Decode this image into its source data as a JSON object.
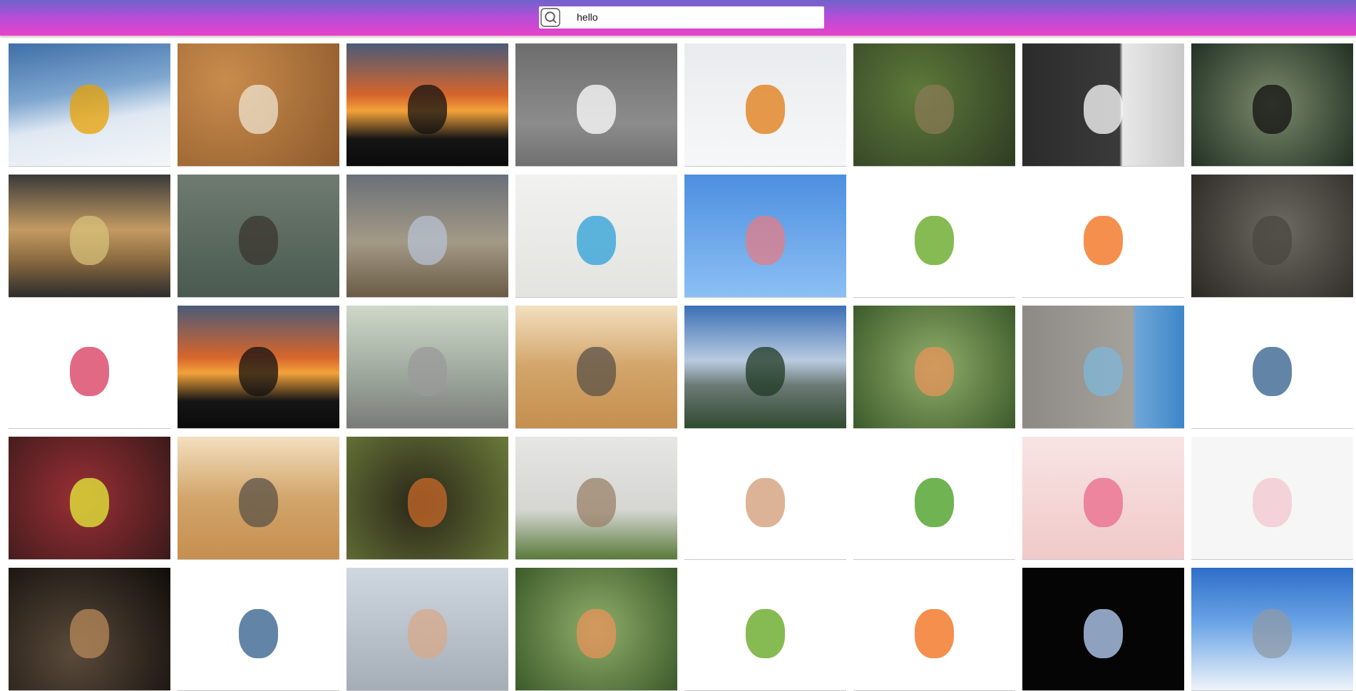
{
  "search": {
    "value": "hello",
    "icon": "search-icon"
  },
  "palette": {
    "header_gradient": [
      "#6f63c9",
      "#b14fd8",
      "#ea41c9"
    ]
  },
  "images": [
    {
      "name": "skier-on-slope",
      "bg": "linear-gradient(170deg,#3f6fa8 0%,#7ea6cf 40%,#dfe8f2 62%,#f4f6f8 100%)",
      "accent": "#e8a000"
    },
    {
      "name": "scrabble-tiles-all",
      "bg": "radial-gradient(circle at 30% 30%,#c98c4c,#8e5a2c)",
      "accent": "#efe3cf"
    },
    {
      "name": "hikers-silhouette-sunset",
      "bg": "linear-gradient(180deg,#4b5b78 0%,#d6652c 42%,#f3a23a 55%,#151515 78%,#0b0b0b 100%)",
      "accent": "#111111"
    },
    {
      "name": "hello-kitty-figure",
      "bg": "linear-gradient(180deg,#6d6d6d 0%,#8c8c8c 65%,#707070 100%)",
      "accent": "#ffffff"
    },
    {
      "name": "hello-mug-and-phone",
      "bg": "linear-gradient(180deg,#e9ecee 0%,#f6f7f8 100%)",
      "accent": "#e07a10"
    },
    {
      "name": "flowers-in-vase-cafe",
      "bg": "radial-gradient(circle at 40% 40%,#5d7a3a,#2f3b23)",
      "accent": "#8a7a55"
    },
    {
      "name": "bonjour-door",
      "bg": "linear-gradient(90deg,#2b2b2b 0%,#3a3a3a 60%,#e8e8e8 62%,#c9c9c9 100%)",
      "accent": "#ffffff"
    },
    {
      "name": "hello-rainy-window",
      "bg": "radial-gradient(circle at 50% 50%,#7a8a6a,#223024)",
      "accent": "#111111"
    },
    {
      "name": "beach-sunset-people",
      "bg": "linear-gradient(180deg,#3a3a3a 0%,#c49a62 45%,#8a6a3f 70%,#2d2d2d 100%)",
      "accent": "#d7c07a"
    },
    {
      "name": "seal-waving",
      "bg": "linear-gradient(180deg,#6f7b70 0%,#4a5a50 100%)",
      "accent": "#3a352d"
    },
    {
      "name": "crane-in-field",
      "bg": "linear-gradient(180deg,#6a6f79 0%,#a39a86 55%,#6a5b46 100%)",
      "accent": "#b7c2d3"
    },
    {
      "name": "notebook-hello-speech-bubbles",
      "bg": "linear-gradient(180deg,#f1f1ef 0%,#e3e3e0 100%)",
      "accent": "#2ba0d8"
    },
    {
      "name": "ostrich-open-beak",
      "bg": "linear-gradient(180deg,#4d8fe0 0%,#8cc0f4 100%)",
      "accent": "#e47c86"
    },
    {
      "name": "frog-hello-light-switch",
      "bg": "#ffffff",
      "accent": "#5da31a"
    },
    {
      "name": "dog-hello-light-switch",
      "bg": "#ffffff",
      "accent": "#f26a11"
    },
    {
      "name": "tortoise-closeup",
      "bg": "radial-gradient(circle at 55% 45%,#6d6a62,#2a2824)",
      "accent": "#4a4740"
    },
    {
      "name": "hello-kitty-lollipop",
      "bg": "#ffffff",
      "accent": "#d8375a"
    },
    {
      "name": "hikers-silhouette-sunset-2",
      "bg": "linear-gradient(180deg,#4b5b78 0%,#d6652c 42%,#f3a23a 55%,#151515 78%,#0b0b0b 100%)",
      "accent": "#111111"
    },
    {
      "name": "stone-statue-waving",
      "bg": "linear-gradient(180deg,#cfd8c8 0%,#9aa59a 60%,#7a7a78 100%)",
      "accent": "#9a9a9a"
    },
    {
      "name": "cat-and-hand",
      "bg": "linear-gradient(180deg,#f3dfc0 0%,#d2a56a 50%,#c58f4f 100%)",
      "accent": "#5a5247"
    },
    {
      "name": "mountain-forest-view",
      "bg": "linear-gradient(180deg,#3c6fb6 0%,#b9cbe0 45%,#6c7a76 65%,#2f4a2f 100%)",
      "accent": "#1f3a23"
    },
    {
      "name": "goose-closeup",
      "bg": "radial-gradient(circle at 50% 50%,#8fae6a,#3c5a2a)",
      "accent": "#e8935a"
    },
    {
      "name": "hello-beautiful-wall",
      "bg": "linear-gradient(90deg,#8d8a86 0%,#a5a19b 68%,#6fa6d8 70%,#3d86c9 100%)",
      "accent": "#7fb7d9"
    },
    {
      "name": "woman-surprised-red-hair",
      "bg": "#ffffff",
      "accent": "#2d5b8a"
    },
    {
      "name": "woman-yellow-dress-on-rug",
      "bg": "radial-gradient(circle at 45% 50%,#9a2f35,#3b1a1a)",
      "accent": "#e6f03a"
    },
    {
      "name": "cat-and-hand-2",
      "bg": "linear-gradient(180deg,#f3dfc0 0%,#d2a56a 50%,#c58f4f 100%)",
      "accent": "#5a5247"
    },
    {
      "name": "fox-cub-in-den",
      "bg": "radial-gradient(circle at 45% 55%,#2a2618,#6a7a3a)",
      "accent": "#c96a2a"
    },
    {
      "name": "cow-in-fog",
      "bg": "linear-gradient(180deg,#e6e6e4 0%,#d5d6d2 60%,#5a7a3a 100%)",
      "accent": "#9a826a"
    },
    {
      "name": "waving-hand",
      "bg": "#ffffff",
      "accent": "#d29a74"
    },
    {
      "name": "frog-figurine-waving",
      "bg": "#ffffff",
      "accent": "#3f9a1a"
    },
    {
      "name": "pink-flowers",
      "bg": "linear-gradient(180deg,#f8e4e4 0%,#f1c9c9 100%)",
      "accent": "#e86a8a"
    },
    {
      "name": "hello-card-and-glasses",
      "bg": "#f6f6f6",
      "accent": "#f2c5cf"
    },
    {
      "name": "frog-figurine-dark",
      "bg": "radial-gradient(circle at 40% 70%,#5a4a3a,#0f0c0a)",
      "accent": "#b78a5a"
    },
    {
      "name": "woman-surprised-red-hair-2",
      "bg": "#ffffff",
      "accent": "#2d5b8a"
    },
    {
      "name": "praying-hands",
      "bg": "linear-gradient(180deg,#cfd7e1 0%,#a5adb7 100%)",
      "accent": "#d7a98a"
    },
    {
      "name": "goose-closeup-2",
      "bg": "radial-gradient(circle at 50% 50%,#8fae6a,#3c5a2a)",
      "accent": "#e8935a"
    },
    {
      "name": "frog-hello-light-switch-2",
      "bg": "#ffffff",
      "accent": "#5da31a"
    },
    {
      "name": "dog-hello-light-switch-2",
      "bg": "#ffffff",
      "accent": "#f26a11"
    },
    {
      "name": "water-splash-dark",
      "bg": "#050505",
      "accent": "#bcd7ff"
    },
    {
      "name": "dolphin-sky",
      "bg": "linear-gradient(180deg,#2f6ec9 0%,#6aa4e6 45%,#eef3f9 100%)",
      "accent": "#8f9aa6"
    }
  ]
}
